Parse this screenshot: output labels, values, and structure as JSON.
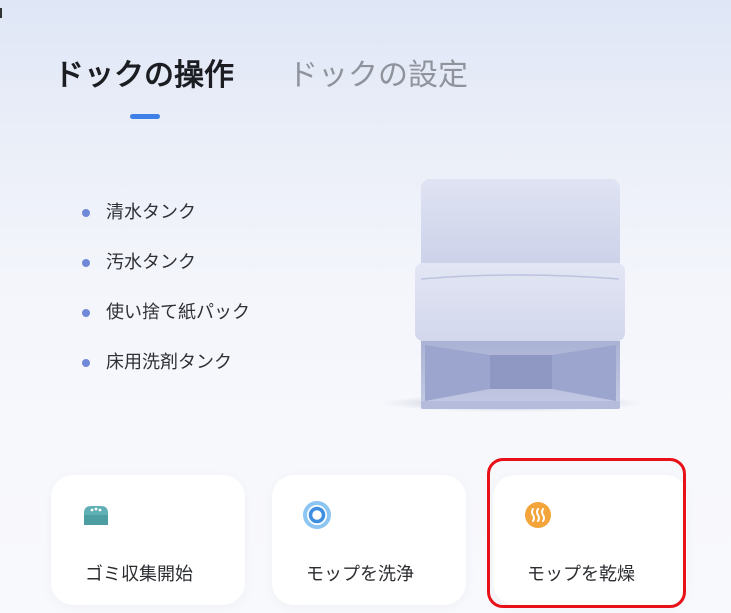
{
  "tabs": [
    {
      "label": "ドックの操作",
      "active": true
    },
    {
      "label": "ドックの設定",
      "active": false
    }
  ],
  "dock_parts": [
    "清水タンク",
    "汚水タンク",
    "使い捨て紙パック",
    "床用洗剤タンク"
  ],
  "actions": [
    {
      "label": "ゴミ収集開始",
      "icon": "dust-bin-icon"
    },
    {
      "label": "モップを洗浄",
      "icon": "mop-wash-icon"
    },
    {
      "label": "モップを乾燥",
      "icon": "mop-dry-icon"
    }
  ],
  "colors": {
    "accent": "#3f7fe8",
    "bullet": "#6f89d8",
    "highlight": "#e8111a",
    "dust_icon": "#5fb0b4",
    "wash_icon": "#3e8fe0",
    "dry_icon": "#f3a43a"
  }
}
